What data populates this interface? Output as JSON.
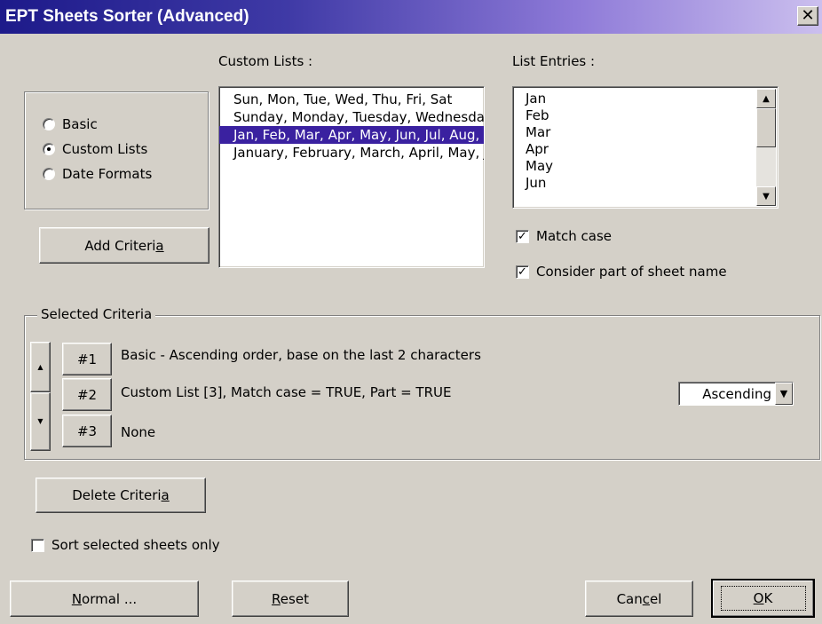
{
  "window": {
    "title": "EPT Sheets Sorter (Advanced)",
    "close_glyph": "✕"
  },
  "mode": {
    "options": [
      {
        "label": "Basic",
        "selected": false
      },
      {
        "label": "Custom Lists",
        "selected": true
      },
      {
        "label": "Date Formats",
        "selected": false
      }
    ]
  },
  "custom_lists": {
    "label": "Custom Lists :",
    "items": [
      "Sun, Mon, Tue, Wed, Thu, Fri, Sat",
      "Sunday, Monday, Tuesday, Wednesday, Thursday, Friday, Saturday",
      "Jan, Feb, Mar, Apr, May, Jun, Jul, Aug, Sep, Oct, Nov, Dec",
      "January, February, March, April, May, June, July, August, September, October, November, December"
    ],
    "selected_index": 2
  },
  "list_entries": {
    "label": "List Entries :",
    "items": [
      "Jan",
      "Feb",
      "Mar",
      "Apr",
      "May",
      "Jun"
    ]
  },
  "options": {
    "match_case": {
      "label": "Match case",
      "checked": true
    },
    "part_of_name": {
      "label": "Consider part of sheet name",
      "checked": true
    }
  },
  "buttons": {
    "add_criteria": {
      "pre": "Add Criteri",
      "accel": "a",
      "post": ""
    },
    "delete_criteria": {
      "pre": "Delete Criteri",
      "accel": "a",
      "post": ""
    },
    "normal": {
      "pre": "",
      "accel": "N",
      "post": "ormal ..."
    },
    "reset": {
      "pre": "",
      "accel": "R",
      "post": "eset"
    },
    "cancel": {
      "pre": "Can",
      "accel": "c",
      "post": "el"
    },
    "ok": {
      "pre": "",
      "accel": "O",
      "post": "K"
    }
  },
  "selected_criteria": {
    "title": "Selected Criteria",
    "rows": [
      {
        "num": "#1",
        "text": "Basic - Ascending order, base on the last 2 characters"
      },
      {
        "num": "#2",
        "text": "Custom List [3], Match case = TRUE, Part = TRUE"
      },
      {
        "num": "#3",
        "text": "None"
      }
    ],
    "order": "Ascending"
  },
  "sort_selected": {
    "label": "Sort selected sheets only",
    "checked": false
  }
}
